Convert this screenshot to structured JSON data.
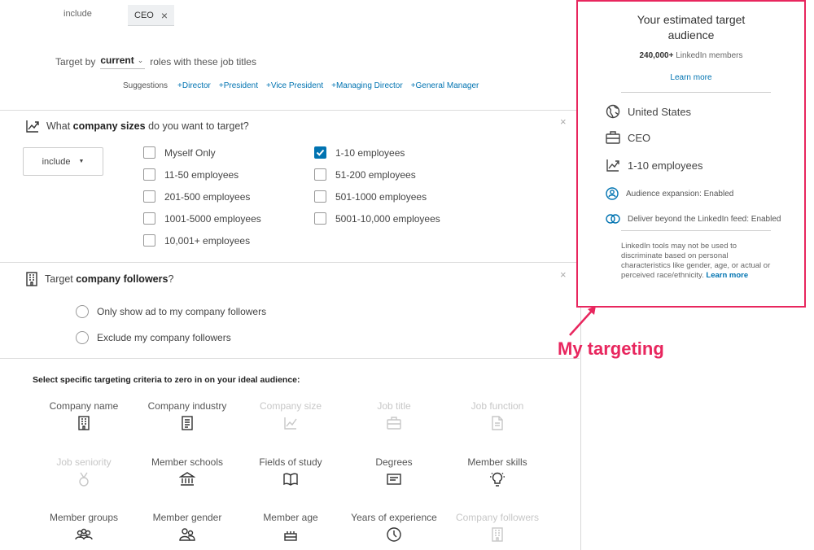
{
  "job_titles": {
    "include_label": "include",
    "tag_label": "CEO",
    "target_by_prefix": "Target by",
    "target_by_value": "current",
    "target_by_suffix": "roles with these job titles",
    "suggestions_label": "Suggestions",
    "suggestions": [
      "+Director",
      "+President",
      "+Vice President",
      "+Managing Director",
      "+General Manager"
    ]
  },
  "company_sizes": {
    "title_prefix": "What ",
    "title_bold": "company sizes",
    "title_suffix": " do you want to target?",
    "include_dropdown": "include",
    "options": [
      {
        "label": "Myself Only",
        "checked": false
      },
      {
        "label": "11-50 employees",
        "checked": false
      },
      {
        "label": "201-500 employees",
        "checked": false
      },
      {
        "label": "1001-5000 employees",
        "checked": false
      },
      {
        "label": "10,001+ employees",
        "checked": false
      },
      {
        "label": "1-10 employees",
        "checked": true
      },
      {
        "label": "51-200 employees",
        "checked": false
      },
      {
        "label": "501-1000 employees",
        "checked": false
      },
      {
        "label": "5001-10,000 employees",
        "checked": false
      }
    ]
  },
  "followers": {
    "title_prefix": "Target ",
    "title_bold": "company followers",
    "title_suffix": "?",
    "options": [
      "Only show ad to my company followers",
      "Exclude my company followers"
    ]
  },
  "criteria": {
    "title": "Select specific targeting criteria to zero in on your ideal audience:",
    "items": [
      {
        "label": "Company name",
        "icon": "building-icon",
        "enabled": true
      },
      {
        "label": "Company industry",
        "icon": "industry-icon",
        "enabled": true
      },
      {
        "label": "Company size",
        "icon": "chart-icon",
        "enabled": false
      },
      {
        "label": "Job title",
        "icon": "briefcase-icon",
        "enabled": false
      },
      {
        "label": "Job function",
        "icon": "document-icon",
        "enabled": false
      },
      {
        "label": "Job seniority",
        "icon": "medal-icon",
        "enabled": false
      },
      {
        "label": "Member schools",
        "icon": "school-icon",
        "enabled": true
      },
      {
        "label": "Fields of study",
        "icon": "book-icon",
        "enabled": true
      },
      {
        "label": "Degrees",
        "icon": "certificate-icon",
        "enabled": true
      },
      {
        "label": "Member skills",
        "icon": "lightbulb-icon",
        "enabled": true
      },
      {
        "label": "Member groups",
        "icon": "group-icon",
        "enabled": true
      },
      {
        "label": "Member gender",
        "icon": "people-icon",
        "enabled": true
      },
      {
        "label": "Member age",
        "icon": "cake-icon",
        "enabled": true
      },
      {
        "label": "Years of experience",
        "icon": "clock-icon",
        "enabled": true
      },
      {
        "label": "Company followers",
        "icon": "building-icon",
        "enabled": false
      }
    ]
  },
  "audience": {
    "title": "Your estimated target audience",
    "members_count": "240,000+",
    "members_suffix": "LinkedIn members",
    "learn_more": "Learn more",
    "location": "United States",
    "job_title": "CEO",
    "company_size": "1-10 employees",
    "expansion": "Audience expansion:  Enabled",
    "deliver": "Deliver beyond the LinkedIn feed:  Enabled",
    "note": "LinkedIn tools may not be used to discriminate based on personal characteristics like gender, age, or actual or perceived race/ethnicity.",
    "note_link": "Learn more"
  },
  "annotation": "My targeting",
  "colors": {
    "accent": "#0073b1",
    "highlight": "#e8265e"
  }
}
